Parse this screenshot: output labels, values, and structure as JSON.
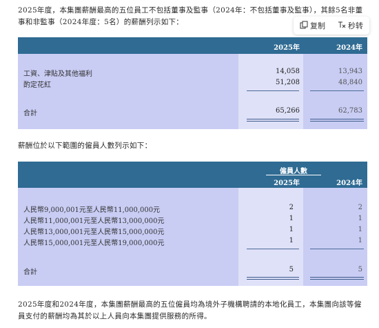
{
  "intro_text": "2025年度，本集團薪酬最高的五位員工不包括董事及監事（2024年：不包括董事及監事），其餘5名非董事和非監事（2024年度：5名）的薪酬列示如下：",
  "toolbar": {
    "copy_label": "复制",
    "seconds_label": "秒转"
  },
  "table1": {
    "col_2025": "2025年",
    "col_2024": "2024年",
    "rows": [
      {
        "label": "工資、津貼及其他福利",
        "v2025": "14,058",
        "v2024": "13,943"
      },
      {
        "label": "酌定花紅",
        "v2025": "51,208",
        "v2024": "48,840"
      }
    ],
    "total": {
      "label": "合計",
      "v2025": "65,266",
      "v2024": "62,783"
    }
  },
  "band_intro": "薪酬位於以下範圍的僱員人數列示如下：",
  "table2": {
    "group_header": "僱員人數",
    "col_2025": "2025年",
    "col_2024": "2024年",
    "rows": [
      {
        "label": "人民幣9,000,001元至人民幣11,000,000元",
        "v2025": "2",
        "v2024": "2"
      },
      {
        "label": "人民幣11,000,001元至人民幣13,000,000元",
        "v2025": "1",
        "v2024": "1"
      },
      {
        "label": "人民幣13,000,001元至人民幣15,000,000元",
        "v2025": "1",
        "v2024": "1"
      },
      {
        "label": "人民幣15,000,001元至人民幣19,000,000元",
        "v2025": "1",
        "v2024": "1"
      }
    ],
    "total": {
      "label": "合計",
      "v2025": "5",
      "v2024": "5"
    }
  },
  "footer_text": "2025年度和2024年度，本集團薪酬最高的五位僱員均為境外子機構聘請的本地化員工，本集團向該等僱員支付的薪酬均為其於以上人員向本集團提供服務的所得。",
  "colors": {
    "header_bg": "#2f6b93",
    "body_bg": "#c9cdf4",
    "highlight_col": "#dfe1f8"
  }
}
